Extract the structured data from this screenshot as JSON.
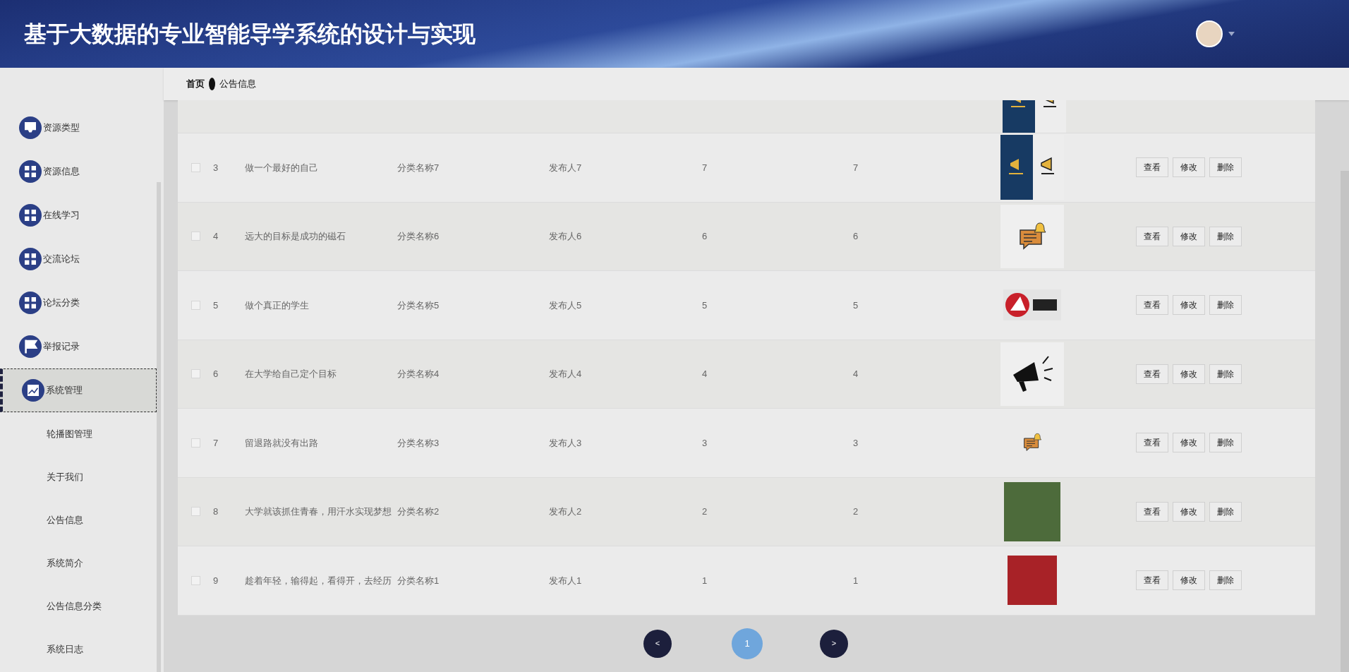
{
  "header": {
    "title": "基于大数据的专业智能导学系统的设计与实现"
  },
  "sidebar": {
    "items": [
      {
        "label": "资源类型",
        "kind": "tray",
        "selected": false
      },
      {
        "label": "资源信息",
        "kind": "grid",
        "selected": false
      },
      {
        "label": "在线学习",
        "kind": "grid",
        "selected": false
      },
      {
        "label": "交流论坛",
        "kind": "grid",
        "selected": false
      },
      {
        "label": "论坛分类",
        "kind": "grid",
        "selected": false
      },
      {
        "label": "举报记录",
        "kind": "flag",
        "selected": false
      },
      {
        "label": "系统管理",
        "kind": "chart",
        "selected": true,
        "children": [
          {
            "label": "轮播图管理",
            "selected": false
          },
          {
            "label": "关于我们",
            "selected": false
          },
          {
            "label": "公告信息",
            "selected": false
          },
          {
            "label": "系统简介",
            "selected": false
          },
          {
            "label": "公告信息分类",
            "selected": false
          },
          {
            "label": "系统日志",
            "selected": false
          }
        ]
      }
    ]
  },
  "breadcrumb": [
    {
      "label": "首页",
      "current": false
    },
    {
      "label": "公告信息",
      "current": true
    }
  ],
  "table": {
    "partial_row": {
      "image": {
        "kind": "megaphone-poster"
      }
    },
    "rows": [
      {
        "checked": false,
        "index": "3",
        "title": "做一个最好的自己",
        "category": "分类名称7",
        "publisher": "发布人7",
        "column_5": "7",
        "column_6": "7",
        "image": {
          "kind": "megaphone-poster"
        },
        "actions": [
          "查看",
          "修改",
          "删除"
        ]
      },
      {
        "checked": false,
        "index": "4",
        "title": "远大的目标是成功的磁石",
        "category": "分类名称6",
        "publisher": "发布人6",
        "column_5": "6",
        "column_6": "6",
        "image": {
          "kind": "chat-bell"
        },
        "actions": [
          "查看",
          "修改",
          "删除"
        ]
      },
      {
        "checked": false,
        "index": "5",
        "title": "做个真正的学生",
        "category": "分类名称5",
        "publisher": "发布人5",
        "column_5": "5",
        "column_6": "5",
        "image": {
          "kind": "logo"
        },
        "actions": [
          "查看",
          "修改",
          "删除"
        ]
      },
      {
        "checked": false,
        "index": "6",
        "title": "在大学给自己定个目标",
        "category": "分类名称4",
        "publisher": "发布人4",
        "column_5": "4",
        "column_6": "4",
        "image": {
          "kind": "megaphone"
        },
        "actions": [
          "查看",
          "修改",
          "删除"
        ]
      },
      {
        "checked": false,
        "index": "7",
        "title": "留退路就没有出路",
        "category": "分类名称3",
        "publisher": "发布人3",
        "column_5": "3",
        "column_6": "3",
        "image": {
          "kind": "chat-bell-small"
        },
        "actions": [
          "查看",
          "修改",
          "删除"
        ]
      },
      {
        "checked": false,
        "index": "8",
        "title": "大学就该抓住青春，用汗水实现梦想",
        "category": "分类名称2",
        "publisher": "发布人2",
        "column_5": "2",
        "column_6": "2",
        "image": {
          "kind": "square-poster"
        },
        "actions": [
          "查看",
          "修改",
          "删除"
        ]
      },
      {
        "checked": false,
        "index": "9",
        "title": "趁着年轻，输得起，看得开，去经历",
        "category": "分类名称1",
        "publisher": "发布人1",
        "column_5": "1",
        "column_6": "1",
        "image": {
          "kind": "small-poster"
        },
        "actions": [
          "查看",
          "修改",
          "删除"
        ]
      }
    ]
  },
  "pagination": {
    "prev": "<",
    "pages": [
      {
        "label": "1",
        "selected": true
      }
    ],
    "next": ">"
  }
}
